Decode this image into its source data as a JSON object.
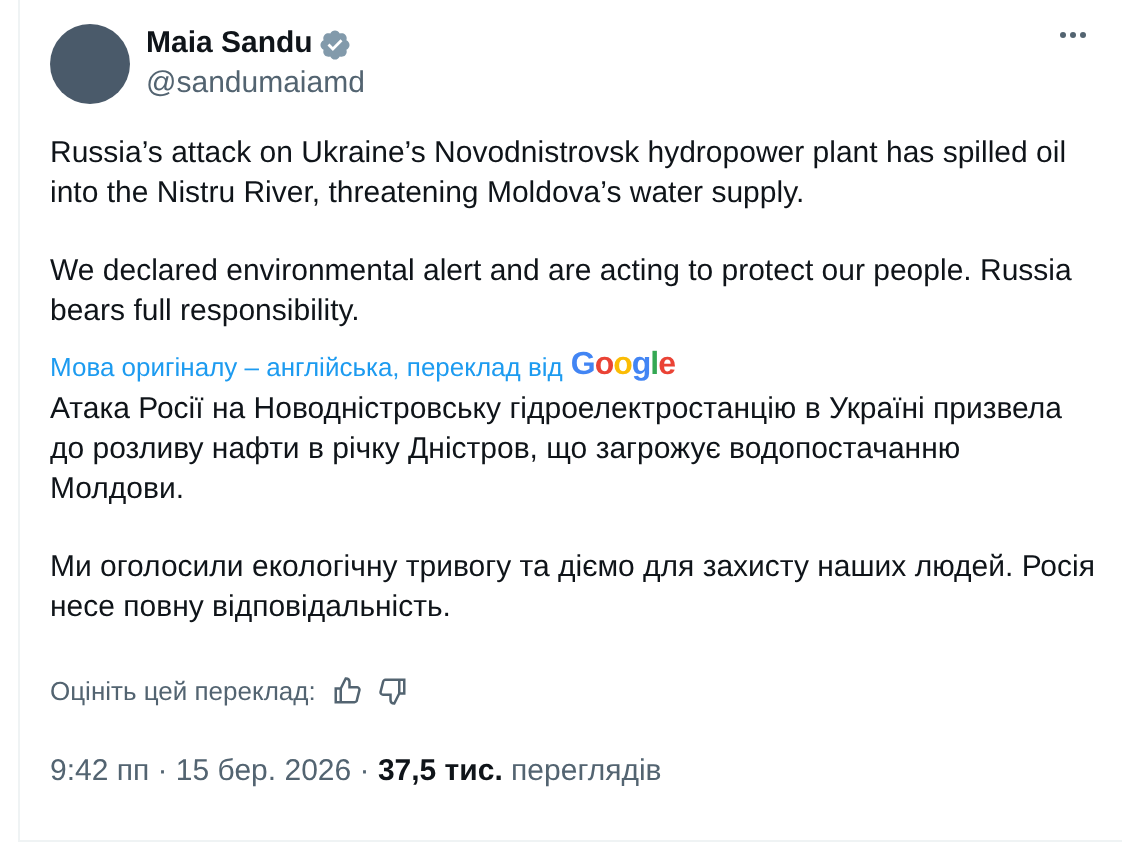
{
  "author": {
    "name": "Maia Sandu",
    "verified": true,
    "handle": "@sandumaiamd"
  },
  "tweet": {
    "paragraphs": [
      "Russia’s attack on Ukraine’s Novodnistrovsk hydropower plant has spilled oil into the Nistru River, threatening Moldova’s water supply.",
      "We declared environmental alert and are acting to protect our people. Russia bears full responsibility."
    ]
  },
  "translation": {
    "source_label": "Мова оригіналу – англійська, переклад від",
    "provider": "Google",
    "paragraphs": [
      "Атака Росії на Новодністровську гідроелектростанцію в Україні призвела до розливу нафти в річку Дністров, що загрожує водопостачанню Молдови.",
      "Ми оголосили екологічну тривогу та діємо для захисту наших людей. Росія несе повну відповідальність."
    ],
    "rate_label": "Оцініть цей переклад:"
  },
  "meta": "9:42 пп · 15 бер. 2026 · **37,5 тис.** переглядів"
}
